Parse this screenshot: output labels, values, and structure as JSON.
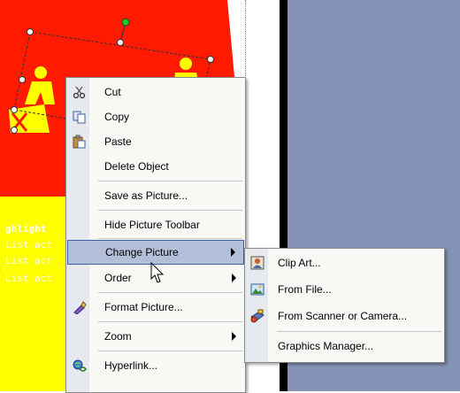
{
  "slide": {
    "yellow_lines": [
      "ghlight",
      "List act",
      "List act",
      "List act"
    ]
  },
  "context_menu": {
    "items": [
      {
        "label": "Cut",
        "icon": "scissors-icon"
      },
      {
        "label": "Copy",
        "icon": "copy-icon"
      },
      {
        "label": "Paste",
        "icon": "paste-icon"
      },
      {
        "label": "Delete Object",
        "icon": ""
      },
      {
        "label": "Save as Picture...",
        "icon": ""
      },
      {
        "label": "Hide Picture Toolbar",
        "icon": ""
      },
      {
        "label": "Change Picture",
        "icon": "",
        "submenu": true,
        "highlighted": true
      },
      {
        "label": "Order",
        "icon": "",
        "submenu": true
      },
      {
        "label": "Format Picture...",
        "icon": "format-picture-icon"
      },
      {
        "label": "Zoom",
        "icon": "",
        "submenu": true
      },
      {
        "label": "Hyperlink...",
        "icon": "hyperlink-icon"
      }
    ]
  },
  "submenu": {
    "items": [
      {
        "label": "Clip Art...",
        "icon": "clip-art-icon"
      },
      {
        "label": "From File...",
        "icon": "picture-file-icon"
      },
      {
        "label": "From Scanner or Camera...",
        "icon": "scanner-camera-icon"
      },
      {
        "label": "Graphics Manager...",
        "icon": ""
      }
    ]
  },
  "colors": {
    "slide_red": "#ff1a00",
    "slide_yellow": "#ffff00",
    "side_panel": "#8492b5",
    "menu_highlight": "#b3bed9",
    "menu_highlight_border": "#3b5fa8"
  }
}
